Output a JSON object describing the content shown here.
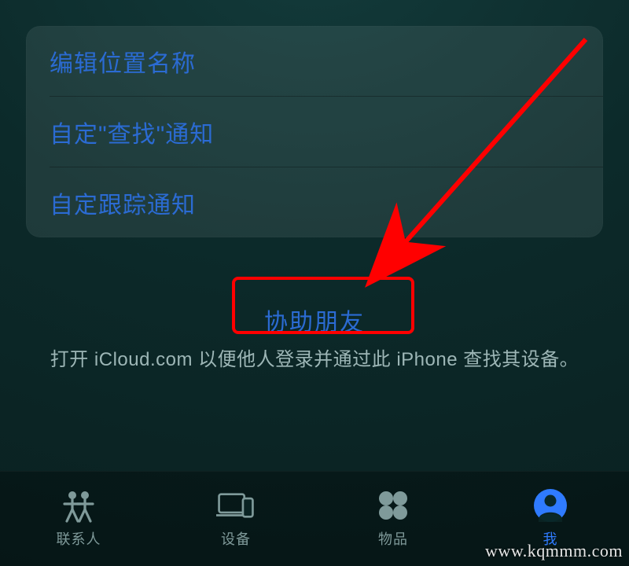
{
  "group": {
    "items": [
      {
        "label": "编辑位置名称"
      },
      {
        "label": "自定\"查找\"通知"
      },
      {
        "label": "自定跟踪通知"
      }
    ]
  },
  "assist": {
    "label": "协助朋友",
    "hint": "打开 iCloud.com 以便他人登录并通过此 iPhone 查找其设备。"
  },
  "tabs": [
    {
      "id": "people",
      "label": "联系人",
      "active": false
    },
    {
      "id": "devices",
      "label": "设备",
      "active": false
    },
    {
      "id": "items",
      "label": "物品",
      "active": false
    },
    {
      "id": "me",
      "label": "我",
      "active": true
    }
  ],
  "watermark": "www.kqmmm.com",
  "annotation": {
    "highlight_target": "assist-friend-button",
    "arrow_color": "#ff0000"
  }
}
